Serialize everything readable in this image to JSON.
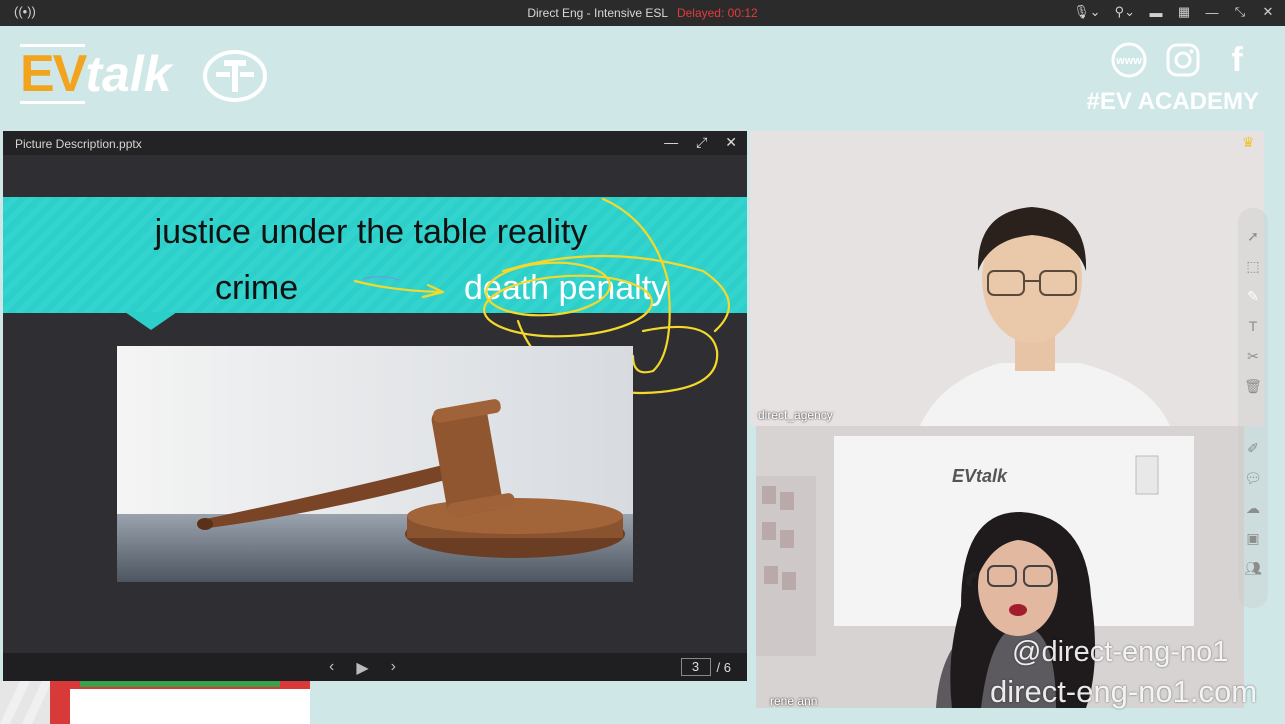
{
  "titlebar": {
    "title": "Direct Eng - Intensive ESL",
    "delay_text": "Delayed: 00:12",
    "icons": [
      "broadcast-icon",
      "microphone-icon",
      "microphone-select-icon",
      "camera-icon",
      "grid-icon",
      "minimize-icon",
      "restore-icon",
      "close-icon"
    ]
  },
  "banner": {
    "logo_ev": "EV",
    "logo_talk": "talk",
    "social": [
      "www",
      "instagram",
      "facebook"
    ],
    "www_label": "www",
    "fb_label": "f",
    "academy": "#EV ACADEMY"
  },
  "presentation": {
    "file_name": "Picture Description.pptx",
    "slide_line1": "justice under the table reality",
    "slide_crime": "crime",
    "slide_death": "death penalty",
    "annotation_color": "#f5d92a",
    "band_color": "#2ccfc9",
    "current_page": "3",
    "total_pages": "/ 6"
  },
  "videos": [
    {
      "name": "direct_agency"
    },
    {
      "name": "rene ann",
      "poster_text": "EVtalk"
    }
  ],
  "watermark": {
    "handle": "@direct-eng-no1",
    "site": "direct-eng-no1.com"
  }
}
